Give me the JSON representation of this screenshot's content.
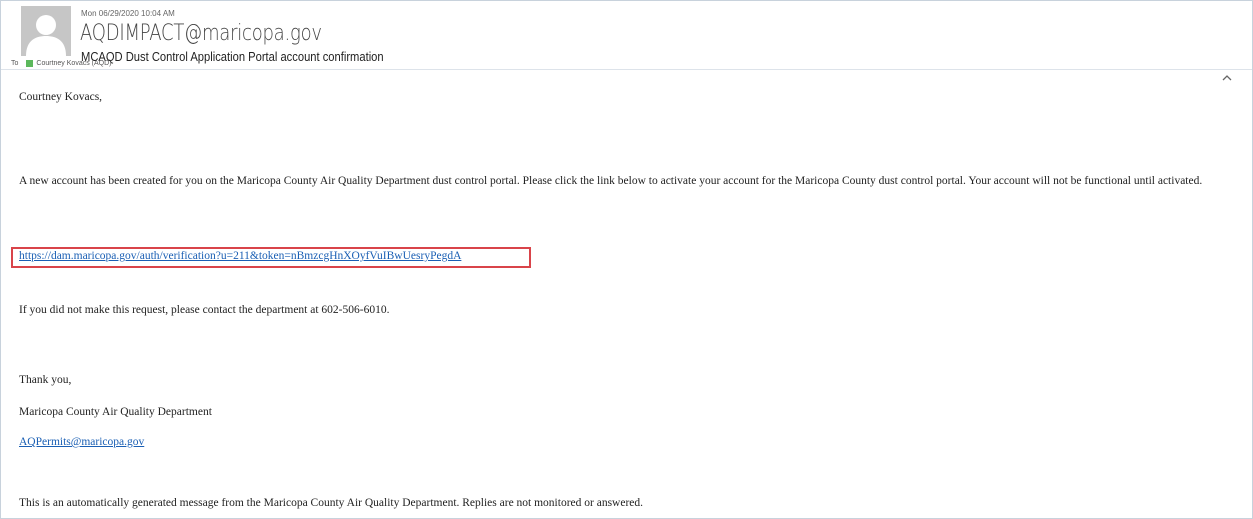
{
  "header": {
    "date": "Mon 06/29/2020 10:04 AM",
    "sender": "AQDIMPACT@maricopa.gov",
    "subject": "MCAQD Dust Control Application Portal account confirmation",
    "to_label": "To",
    "recipient": "Courtney Kovacs (AQD)"
  },
  "icons": {
    "avatar": "avatar-icon",
    "presence": "presence-icon",
    "collapse": "chevron-up-icon"
  },
  "colors": {
    "link": "#1a5fb4",
    "highlight_box": "#d9444a",
    "presence": "#5cb85c"
  },
  "body": {
    "greeting": "Courtney Kovacs,",
    "paragraph1": "A new account has been created for you on the Maricopa County Air Quality Department dust control portal. Please click the link below to activate your account for the Maricopa County dust control portal. Your account will not be functional until activated.",
    "verification_link": "https://dam.maricopa.gov/auth/verification?u=211&token=nBmzcgHnXOyfVuIBwUesryPegdA",
    "contact_note": "If you did not make this request, please contact the department at 602-506-6010.",
    "thanks": "Thank you,",
    "signature": "Maricopa County Air Quality Department",
    "email_link": "AQPermits@maricopa.gov",
    "footer_note": "This is an automatically generated message from the Maricopa County Air Quality Department. Replies are not monitored or answered."
  }
}
